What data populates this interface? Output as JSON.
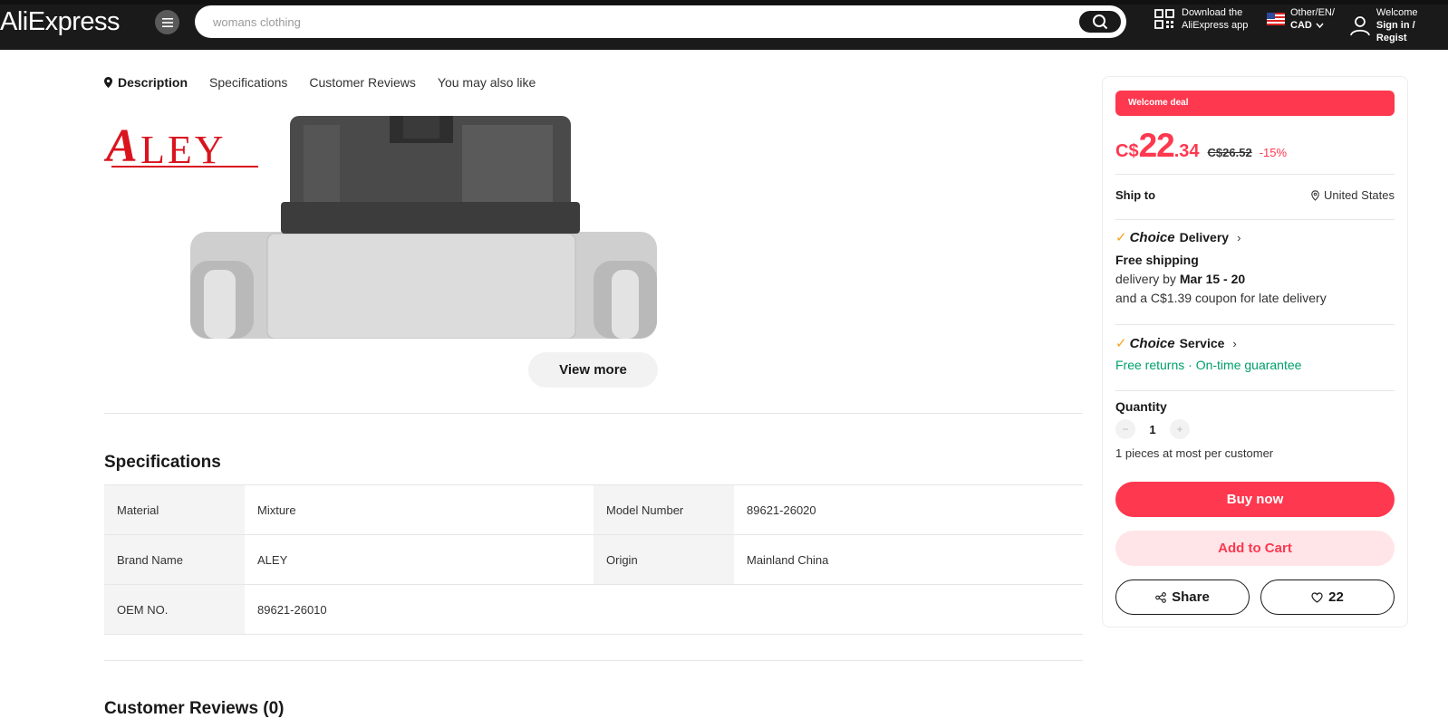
{
  "header": {
    "logo": "AliExpress",
    "search_placeholder": "womans clothing",
    "app_line1": "Download the",
    "app_line2": "AliExpress app",
    "region_line1": "Other/EN/",
    "region_line2": "CAD",
    "account_line1": "Welcome",
    "account_line2": "Sign in / Regist"
  },
  "tabs": [
    "Description",
    "Specifications",
    "Customer Reviews",
    "You may also like"
  ],
  "description": {
    "brand_logo_text": "ALEY",
    "view_more": "View more"
  },
  "specifications": {
    "title": "Specifications",
    "rows": [
      [
        {
          "k": "Material",
          "v": "Mixture"
        },
        {
          "k": "Model Number",
          "v": "89621-26020"
        }
      ],
      [
        {
          "k": "Brand Name",
          "v": "ALEY"
        },
        {
          "k": "Origin",
          "v": "Mainland China"
        }
      ],
      [
        {
          "k": "OEM NO.",
          "v": "89621-26010"
        }
      ]
    ]
  },
  "reviews": {
    "title": "Customer Reviews (0)"
  },
  "panel": {
    "deal_badge": "Welcome deal",
    "price_currency": "C$",
    "price_int": "22",
    "price_dec": ".34",
    "original_price": "C$26.52",
    "discount": "-15%",
    "ship_label": "Ship to",
    "ship_dest": "United States",
    "choice_word": "Choice",
    "delivery_label": "Delivery",
    "free_shipping": "Free shipping",
    "delivery_by": "delivery by",
    "delivery_dates": "Mar 15 - 20",
    "coupon_note": "and a C$1.39 coupon for late delivery",
    "service_label": "Service",
    "free_returns": "Free returns",
    "sep": " · ",
    "on_time": "On-time guarantee",
    "quantity_label": "Quantity",
    "quantity_value": "1",
    "quantity_note": "1 pieces at most per customer",
    "buy_now": "Buy now",
    "add_to_cart": "Add to Cart",
    "share": "Share",
    "wishlist_count": "22"
  },
  "colors": {
    "accent": "#fd384f",
    "choice_check": "#f7a21b",
    "service_green": "#00a06a",
    "header_bg": "#1a1a1a"
  }
}
